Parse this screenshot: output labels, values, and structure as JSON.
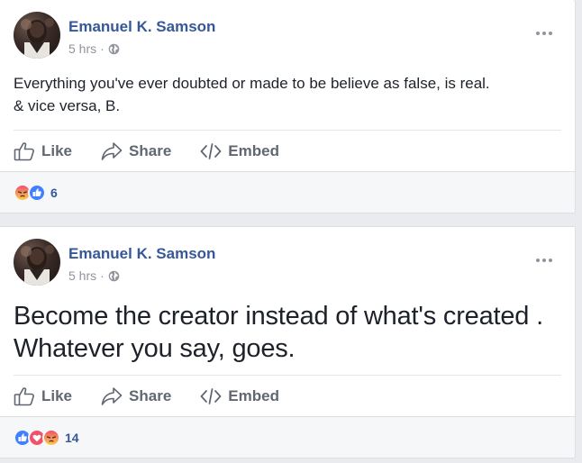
{
  "posts": [
    {
      "author": "Emanuel K. Samson",
      "time": "5 hrs",
      "separator": "·",
      "text_lines": [
        "Everything you've ever doubted or made to be believe as false, is real.",
        "& vice versa, B."
      ],
      "actions": {
        "like": "Like",
        "share": "Share",
        "embed": "Embed"
      },
      "reactions": [
        "angry",
        "like"
      ],
      "reaction_count": "6"
    },
    {
      "author": "Emanuel K. Samson",
      "time": "5 hrs",
      "separator": "·",
      "text_lines": [
        "Become the creator instead of what's created .",
        "Whatever you say, goes."
      ],
      "actions": {
        "like": "Like",
        "share": "Share",
        "embed": "Embed"
      },
      "reactions": [
        "like",
        "love",
        "angry"
      ],
      "reaction_count": "14"
    }
  ],
  "icons": {
    "more": "more-options-icon",
    "privacy": "globe-icon",
    "like": "thumbs-up-icon",
    "share": "share-arrow-icon",
    "embed": "code-embed-icon"
  },
  "colors": {
    "author": "#365899",
    "meta": "#90949c",
    "action": "#616770",
    "like_reaction": "#4080ff",
    "love_reaction": "#f25268",
    "angry_reaction": "#e9710f"
  }
}
